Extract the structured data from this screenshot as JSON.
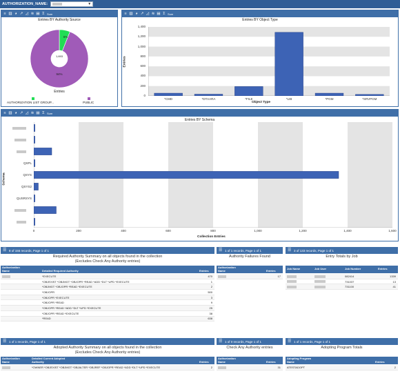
{
  "filter": {
    "label": "AUTHORIZATION_NAME:"
  },
  "toolbar": {
    "sum_label": "Sum"
  },
  "source_chart": {
    "title": "Entries BY Authority Source",
    "center_label": "1,693",
    "slice_small_label": "6%",
    "slice_large_label": "94%",
    "caption": "Entries",
    "legend": [
      {
        "label": "AUTHORIZATION LIST GROUP...",
        "color": "#22dd55"
      },
      {
        "label": "PUBLIC",
        "color": "#a05bb8"
      }
    ]
  },
  "type_chart": {
    "title": "Entries BY Object Type",
    "xlabel": "Object Type",
    "ylabel": "Entries"
  },
  "schema_chart": {
    "title": "Entries BY Schema",
    "xlabel": "Collection Entries",
    "ylabel": "Schema"
  },
  "chart_data": [
    {
      "type": "pie",
      "title": "Entries BY Authority Source",
      "categories": [
        "AUTHORIZATION LIST GROUP...",
        "PUBLIC"
      ],
      "values": [
        6,
        94
      ],
      "center_total": 1693
    },
    {
      "type": "bar",
      "title": "Entries BY Object Type",
      "categories": [
        "*CMD",
        "*DTAARA",
        "*FILE",
        "*LIB",
        "*PGM",
        "*SRVPGM"
      ],
      "values": [
        55,
        35,
        190,
        1290,
        55,
        30
      ],
      "xlabel": "Object Type",
      "ylabel": "Entries",
      "ylim": [
        0,
        1400
      ],
      "yticks": [
        "0",
        "200",
        "400",
        "600",
        "800",
        "1,000",
        "1,200",
        "1,400"
      ]
    },
    {
      "type": "bar",
      "orientation": "horizontal",
      "title": "Entries BY Schema",
      "categories": [
        "",
        "",
        "",
        "QSPL",
        "QSYS",
        "QSYS2",
        "QUSRSYS",
        "",
        ""
      ],
      "values": [
        5,
        5,
        80,
        5,
        1360,
        20,
        5,
        100,
        5
      ],
      "xlabel": "Collection Entries",
      "ylabel": "Schema",
      "xlim": [
        0,
        1600
      ],
      "xticks": [
        "0",
        "200",
        "400",
        "600",
        "800",
        "1,000",
        "1,200",
        "1,400",
        "1,600"
      ]
    }
  ],
  "req_grid": {
    "pager": "8 of 155 records, Page 1 of 1",
    "title_line1": "Required Authority Summary on all objects found in the collection",
    "title_line2": "(Excludes Check Any Authority entries)",
    "col1": "Authorization Name",
    "col2": "Detailed Required Authority",
    "col3": "Entries",
    "rows": [
      {
        "auth": "*EXECUTE",
        "entries": "470"
      },
      {
        "auth": "*OBJEXIST *OBJMGT *OBJOPR *READ *ADD *DLT *UPD *EXECUTE",
        "entries": "1"
      },
      {
        "auth": "*OBJMGT *OBJOPR *READ *EXECUTE",
        "entries": "2"
      },
      {
        "auth": "*OBJOPR",
        "entries": "500"
      },
      {
        "auth": "*OBJOPR *EXECUTE",
        "entries": "3"
      },
      {
        "auth": "*OBJOPR *READ",
        "entries": "9"
      },
      {
        "auth": "*OBJOPR *READ *ADD *DLT *UPD *EXECUTE",
        "entries": "25"
      },
      {
        "auth": "*OBJOPR *READ *EXECUTE",
        "entries": "38"
      },
      {
        "auth": "*READ",
        "entries": "638"
      }
    ]
  },
  "fail_grid": {
    "pager": "1 of 1 records, Page 1 of 1",
    "title": "Authority Failures Found",
    "col1": "Authorization Name",
    "col2": "Entries",
    "rows": [
      {
        "entries": "17"
      }
    ]
  },
  "job_grid": {
    "pager": "3 of 133 records, Page 1 of 1",
    "title": "Entry Totals by Job",
    "col1": "Job Name",
    "col2": "Job User",
    "col3": "Job Number",
    "col4": "Entries",
    "rows": [
      {
        "number": "082414",
        "entries": "1339"
      },
      {
        "number": "731037",
        "entries": "13"
      },
      {
        "number": "731100",
        "entries": "41"
      }
    ]
  },
  "adopt_grid": {
    "pager": "1 of 1 records, Page 1 of 1",
    "title_line1": "Adopted Authority Summary on all objects found in the collection",
    "title_line2": "(Excludes Check Any Authority entries)",
    "col1": "Authorization Name",
    "col2": "Detailed Current Adopted Authority",
    "col3": "Entries",
    "rows": [
      {
        "auth": "*OWNER *OBJEXIST *OBJMGT *OBJALTER *OBJREF *OBJOPR *READ *ADD *DLT *UPD *EXECUTE",
        "entries": "2"
      }
    ]
  },
  "check_grid": {
    "pager": "1 of 0 records, Page 1 of 1",
    "title": "Check Any Authority entries",
    "col1": "Authorization Name",
    "col2": "Entries",
    "rows": [
      {
        "entries": "31"
      }
    ]
  },
  "prog_grid": {
    "pager": "1 of 1 records, Page 1 of 1",
    "title": "Adopting Program Totals",
    "col1": "Adopting Program Name",
    "col2": "Entries",
    "rows": [
      {
        "name": "ATESTADOPT",
        "entries": "2"
      }
    ]
  }
}
